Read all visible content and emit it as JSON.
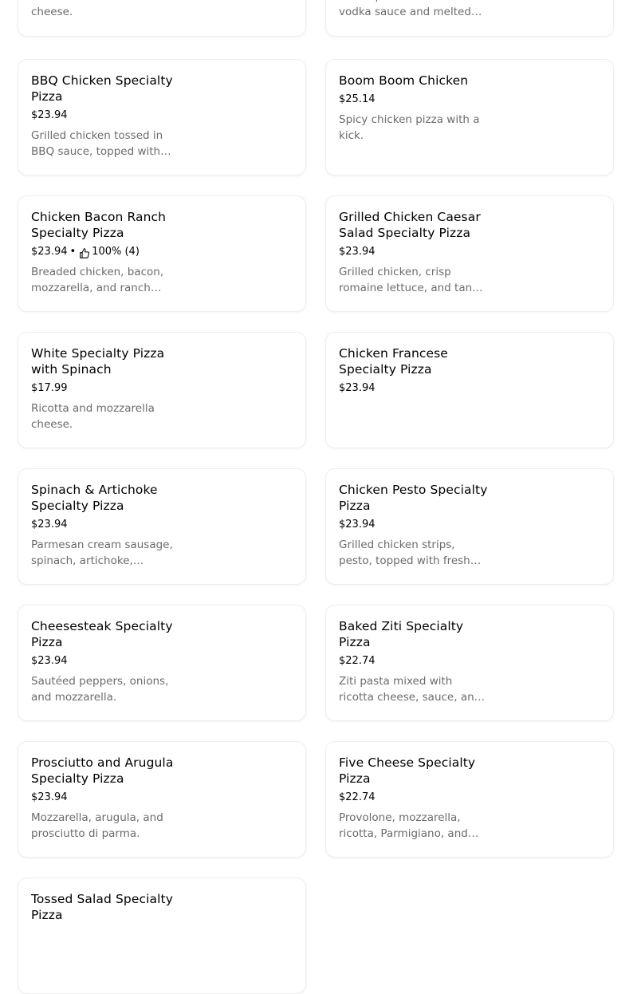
{
  "menu": {
    "top_row": [
      {
        "desc": "Ricotta and mozzarella cheese."
      },
      {
        "desc": "Penne pasta tossed with vodka sauce and melted mozzarella."
      }
    ],
    "items": [
      {
        "title": "BBQ Chicken Specialty Pizza",
        "price": "$23.94",
        "desc": "Grilled chicken tossed in BBQ sauce, topped with mozzarella."
      },
      {
        "title": "Boom Boom Chicken",
        "price": "$25.14",
        "desc": "Spicy chicken pizza with a kick."
      },
      {
        "title": "Chicken Bacon Ranch Specialty Pizza",
        "price": "$23.94",
        "rating": "100% (4)",
        "desc": "Breaded chicken, bacon, mozzarella, and ranch dressing."
      },
      {
        "title": "Grilled Chicken Caesar Salad Specialty Pizza",
        "price": "$23.94",
        "desc": "Grilled chicken, crisp romaine lettuce, and tangy Caesar dressing."
      },
      {
        "title": "White Specialty Pizza with Spinach",
        "price": "$17.99",
        "desc": "Ricotta and mozzarella cheese."
      },
      {
        "title": "Chicken Francese Specialty Pizza",
        "price": "$23.94",
        "desc": ""
      },
      {
        "title": "Spinach & Artichoke Specialty Pizza",
        "price": "$23.94",
        "desc": "Parmesan cream sausage, spinach, artichoke, mozzarella."
      },
      {
        "title": "Chicken Pesto Specialty Pizza",
        "price": "$23.94",
        "desc": "Grilled chicken strips, pesto, topped with fresh mozzarella."
      },
      {
        "title": "Cheesesteak Specialty Pizza",
        "price": "$23.94",
        "desc": "Sautéed peppers, onions, and mozzarella."
      },
      {
        "title": "Baked Ziti Specialty Pizza",
        "price": "$22.74",
        "desc": "Ziti pasta mixed with ricotta cheese, sauce, and mozzarella."
      },
      {
        "title": "Prosciutto and Arugula Specialty Pizza",
        "price": "$23.94",
        "desc": "Mozzarella, arugula, and prosciutto di parma."
      },
      {
        "title": "Five Cheese Specialty Pizza",
        "price": "$22.74",
        "desc": "Provolone, mozzarella, ricotta, Parmigiano, and fontina."
      },
      {
        "title": "Tossed Salad Specialty Pizza",
        "price": "",
        "desc": ""
      }
    ],
    "rating_separator": "•"
  }
}
